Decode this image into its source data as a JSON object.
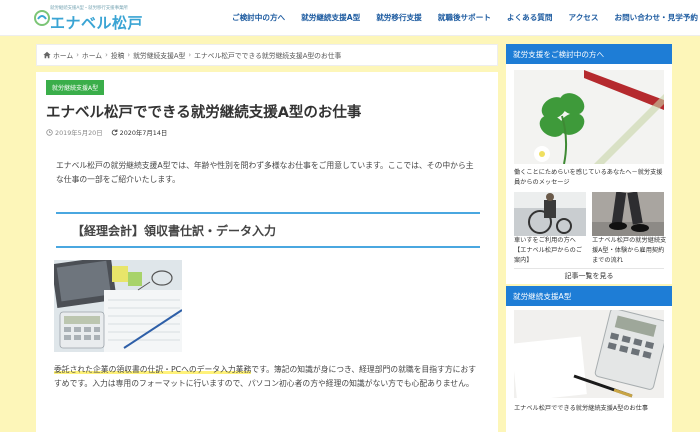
{
  "header": {
    "logo_sub": "就労継続支援A型・就労移行支援事業所",
    "logo_main": "エナベル松戸",
    "nav": [
      "ご検討中の方へ",
      "就労継続支援A型",
      "就労移行支援",
      "就職後サポート",
      "よくある質問",
      "アクセス",
      "お問い合わせ・見学予約"
    ]
  },
  "breadcrumb": [
    "ホーム",
    "ホーム",
    "投稿",
    "就労継続支援A型",
    "エナベル松戸でできる就労継続支援A型のお仕事"
  ],
  "article": {
    "category": "就労継続支援A型",
    "title": "エナベル松戸でできる就労継続支援A型のお仕事",
    "published": "2019年5月20日",
    "updated": "2020年7月14日",
    "intro": "エナベル松戸の就労継続支援A型では、年齢や性別を問わず多様なお仕事をご用意しています。ここでは、その中から主な仕事の一部をご紹介いたします。",
    "section_heading": "【経理会計】領収書仕訳・データ入力",
    "body_highlight": "委託された企業の領収書の仕訳・PCへのデータ入力業務",
    "body_rest": "です。簿記の知識が身につき、経理部門の就職を目指す方におすすめです。入力は専用のフォーマットに行いますので、パソコン初心者の方や経理の知識がない方でも心配ありません。"
  },
  "sidebar": {
    "widget1_title": "就労支援をご検討中の方へ",
    "main_caption": "働くことにためらいを感じているあなたへ－就労支援員からのメッセージ",
    "small_captions": [
      "車いすをご利用の方へ【エナベル松戸からのご案内】",
      "エナベル松戸の就労継続支援A型・体験から雇用契約までの流れ"
    ],
    "more_link": "記事一覧を見る",
    "widget2_title": "就労継続支援A型",
    "widget2_caption": "エナベル松戸でできる就労継続支援A型のお仕事"
  },
  "colors": {
    "accent_blue": "#1e7dd6",
    "category_green": "#3aae4a",
    "page_bg": "#fdf6b9"
  }
}
